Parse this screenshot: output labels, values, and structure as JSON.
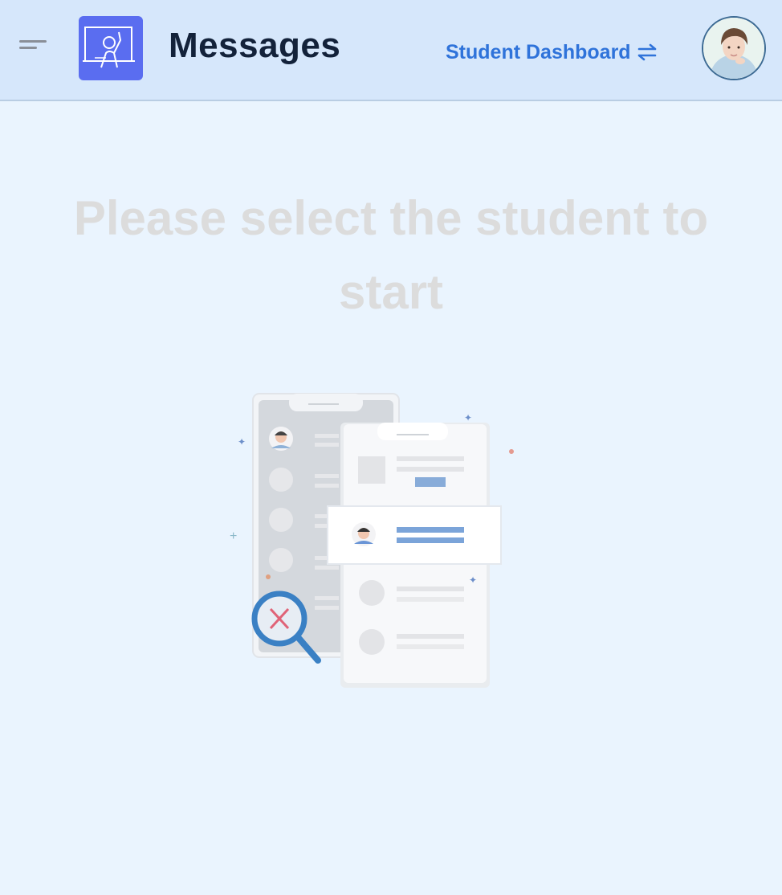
{
  "header": {
    "title": "Messages",
    "switch_label": "Student Dashboard",
    "icons": {
      "menu": "menu-lines-icon",
      "logo": "teacher-at-board-icon",
      "switch": "swap-arrows-icon",
      "avatar": "user-avatar-photo"
    }
  },
  "empty_state": {
    "message": "Please select the student to start",
    "illustration": "empty-search-phones-illustration"
  },
  "colors": {
    "header_bg": "#d6e7fb",
    "page_bg": "#eaf4fe",
    "accent": "#2f73da",
    "logo_bg": "#5a6df0"
  }
}
